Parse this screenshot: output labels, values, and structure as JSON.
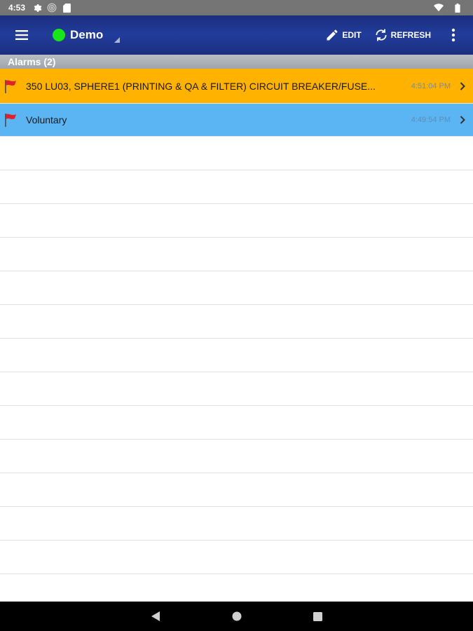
{
  "status_bar": {
    "time": "4:53",
    "icons": [
      "gear-icon",
      "broadcast-icon",
      "sd-card-icon",
      "wifi-icon",
      "battery-icon"
    ]
  },
  "app_bar": {
    "site_name": "Demo",
    "site_status_color": "#19e619",
    "edit_label": "EDIT",
    "refresh_label": "REFRESH",
    "background_color": "#213c9a"
  },
  "section": {
    "title": "Alarms (2)"
  },
  "alarms": [
    {
      "text": "350 LU03, SPHERE1 (PRINTING & QA & FILTER) CIRCUIT BREAKER/FUSE...",
      "time": "4:51:04 PM",
      "color": "#ffb200",
      "icon": "red-flag-icon"
    },
    {
      "text": "Voluntary",
      "time": "4:49:54 PM",
      "color": "#5bb5f2",
      "icon": "red-flag-icon"
    }
  ],
  "nav_bar": {
    "buttons": [
      "back-icon",
      "home-icon",
      "recents-icon"
    ]
  }
}
